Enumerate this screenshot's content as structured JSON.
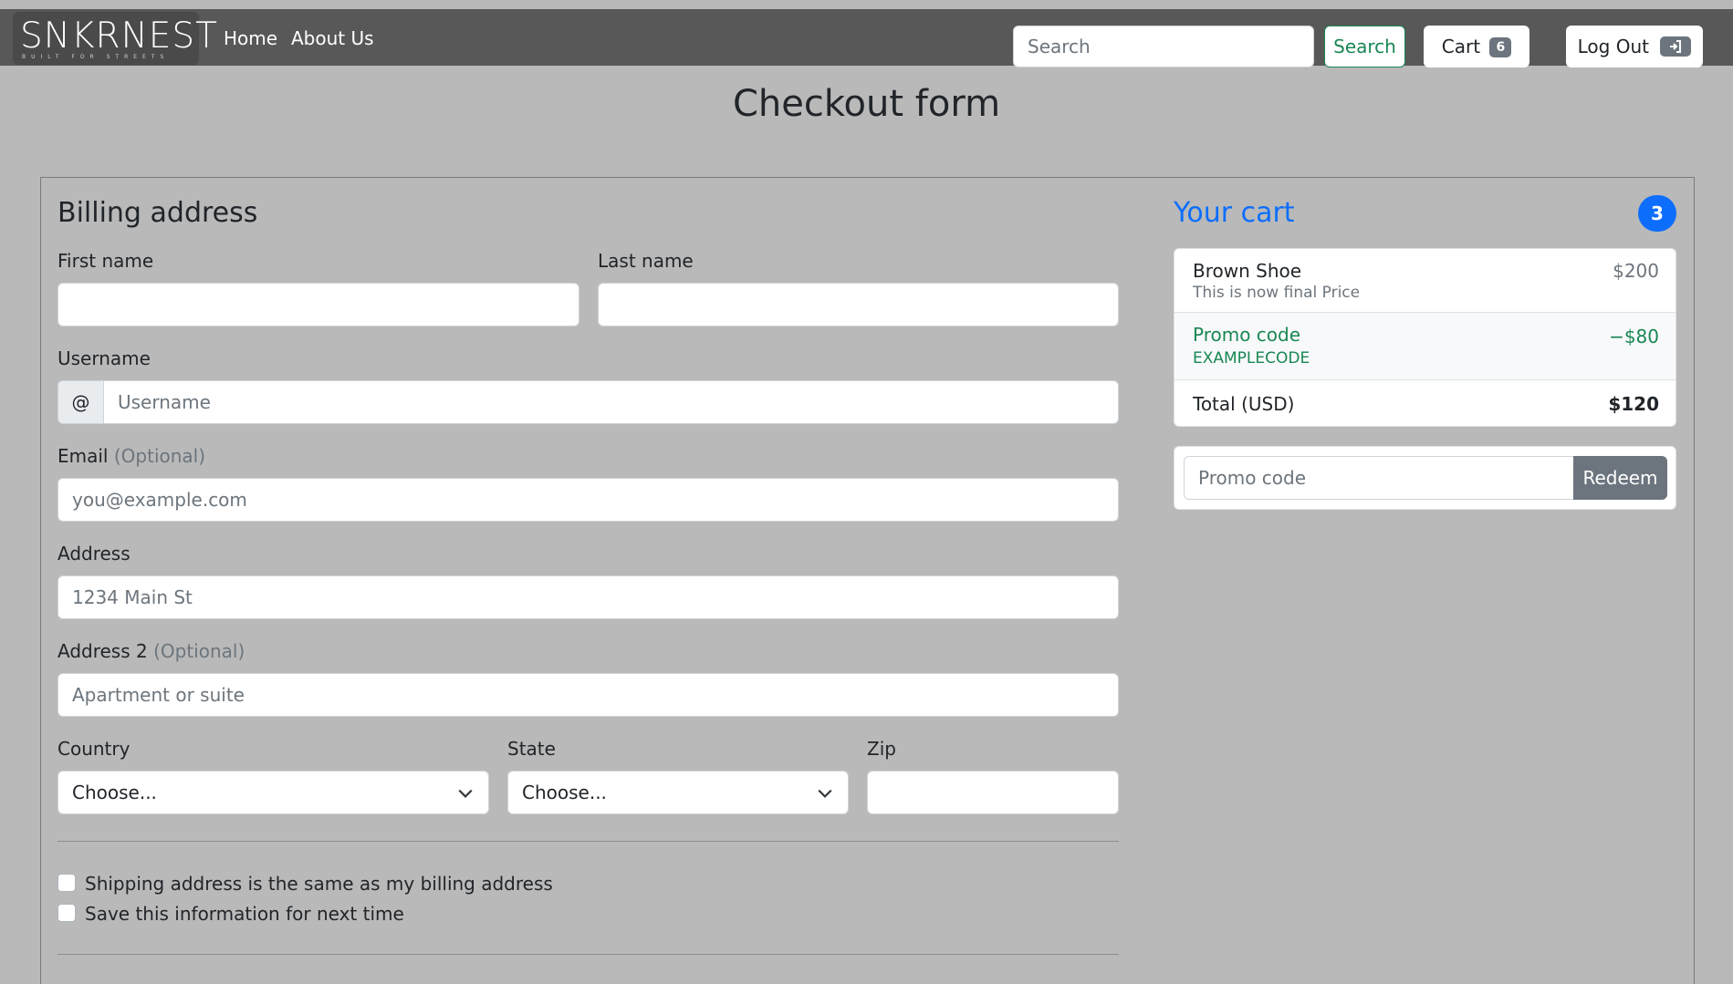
{
  "navbar": {
    "brand_name": "SNKRNEST",
    "brand_tagline": "BUILT FOR STREETS",
    "links": [
      "Home",
      "About Us"
    ],
    "search_placeholder": "Search",
    "search_button": "Search",
    "cart_label": "Cart",
    "cart_count": "6",
    "logout_label": "Log Out"
  },
  "page_title": "Checkout form",
  "billing": {
    "heading": "Billing address",
    "first_name_label": "First name",
    "last_name_label": "Last name",
    "username_label": "Username",
    "username_prefix": "@",
    "username_placeholder": "Username",
    "email_label": "Email",
    "optional": "(Optional)",
    "email_placeholder": "you@example.com",
    "address_label": "Address",
    "address_placeholder": "1234 Main St",
    "address2_label": "Address 2",
    "address2_placeholder": "Apartment or suite",
    "country_label": "Country",
    "country_value": "Choose...",
    "state_label": "State",
    "state_value": "Choose...",
    "zip_label": "Zip",
    "same_address_label": "Shipping address is the same as my billing address",
    "save_info_label": "Save this information for next time"
  },
  "cart": {
    "title": "Your cart",
    "count": "3",
    "items": [
      {
        "name": "Brown Shoe",
        "description": "This is now final Price",
        "price": "$200"
      }
    ],
    "promo": {
      "label": "Promo code",
      "code": "EXAMPLECODE",
      "amount": "−$80"
    },
    "total_label": "Total (USD)",
    "total_value": "$120",
    "promo_placeholder": "Promo code",
    "redeem_button": "Redeem"
  },
  "colors": {
    "navbar_bg": "#585858",
    "page_bg": "#b9b9b9",
    "accent_blue": "#0d6efd",
    "success_green": "#198754",
    "secondary_gray": "#6c757d"
  },
  "icons": [
    "logout-icon",
    "chevron-down-icon"
  ]
}
